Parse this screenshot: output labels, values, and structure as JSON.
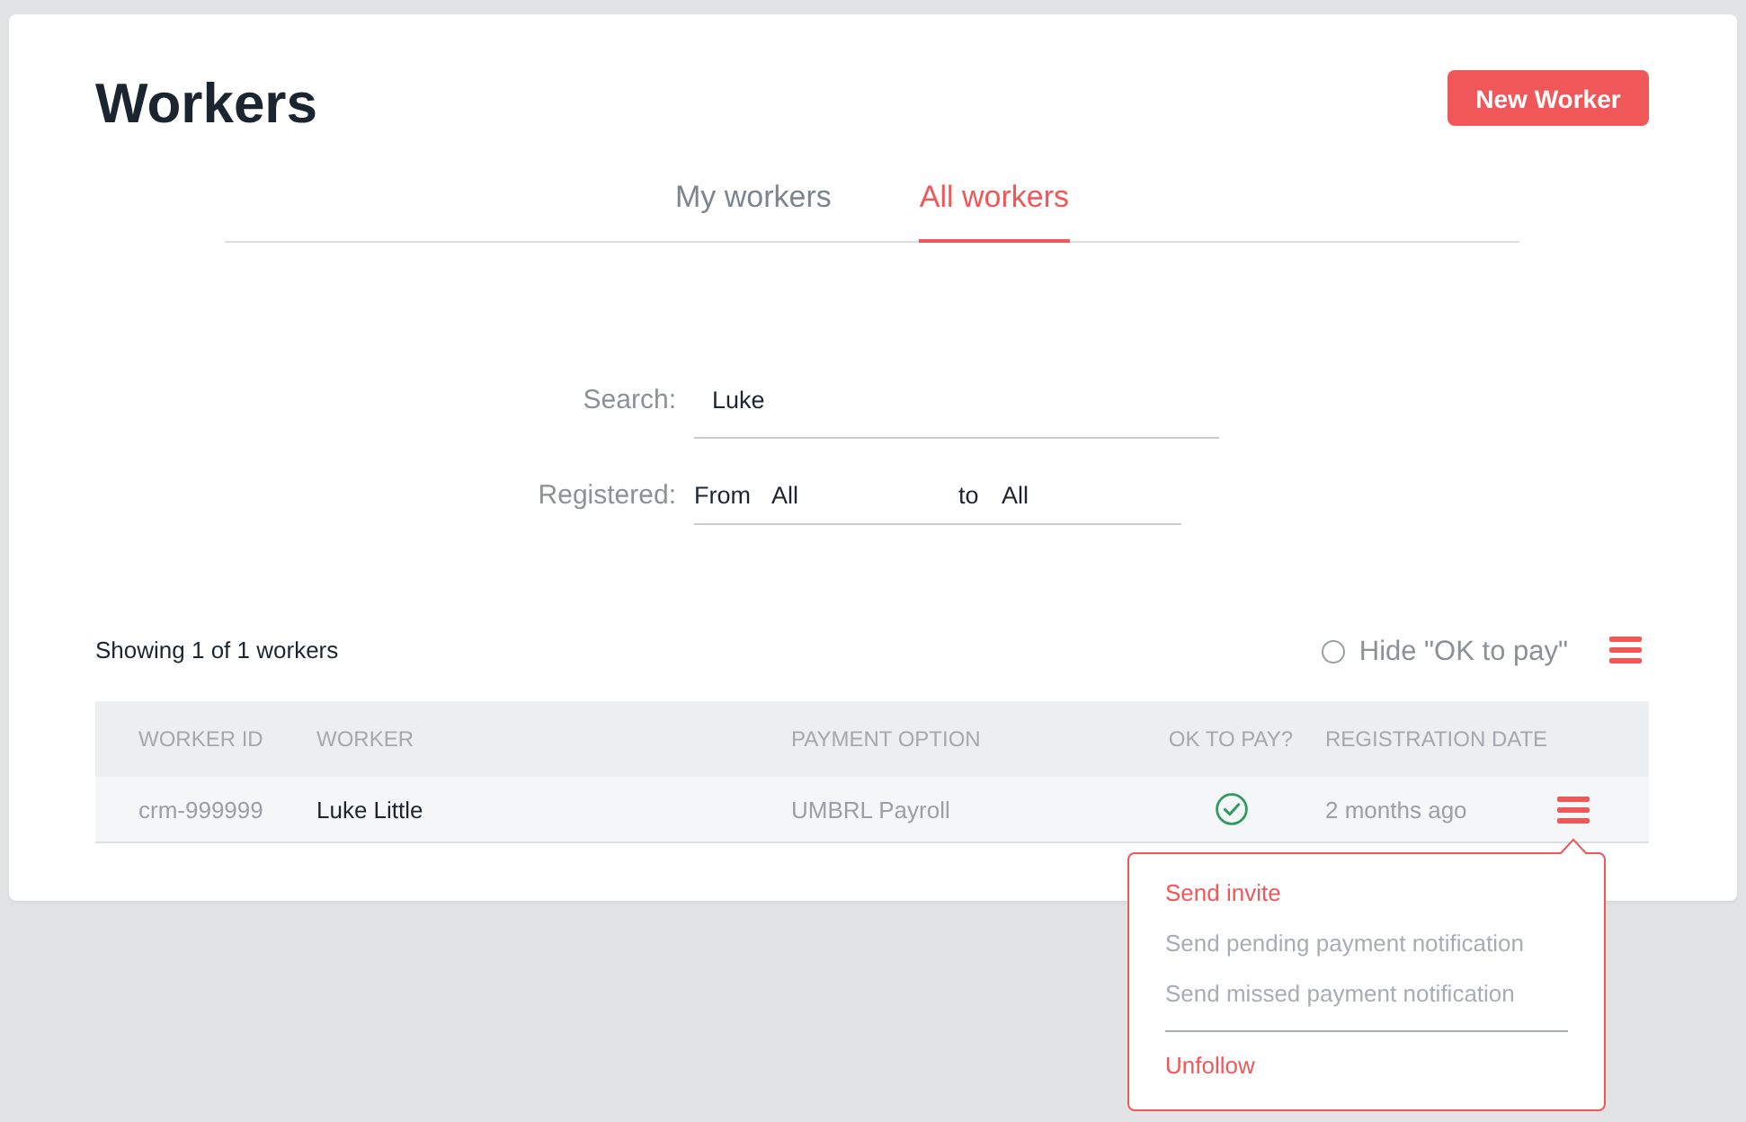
{
  "page": {
    "title": "Workers",
    "new_button": "New Worker"
  },
  "tabs": [
    {
      "label": "My workers",
      "selected": false
    },
    {
      "label": "All workers",
      "selected": true
    }
  ],
  "filters": {
    "search": {
      "label": "Search:",
      "value": "Luke"
    },
    "registered": {
      "label": "Registered:",
      "from_label": "From",
      "from_value": "All",
      "to_label": "to",
      "to_value": "All"
    }
  },
  "toolbar": {
    "summary": "Showing 1 of 1 workers",
    "hide_ok_to_pay": {
      "label": "Hide \"OK to pay\"",
      "checked": false
    }
  },
  "table": {
    "columns": [
      "WORKER ID",
      "WORKER",
      "PAYMENT OPTION",
      "OK TO PAY?",
      "REGISTRATION DATE"
    ],
    "rows": [
      {
        "worker_id": "crm-999999",
        "worker": "Luke Little",
        "payment_option": "UMBRL Payroll",
        "ok_to_pay": true,
        "registration_date": "2 months ago",
        "menu_expanded": true,
        "menu": {
          "sections": [
            {
              "items": [
                {
                  "label": "Send invite",
                  "disabled": false
                },
                {
                  "label": "Send pending payment notification",
                  "disabled": true
                },
                {
                  "label": "Send missed payment notification",
                  "disabled": true
                }
              ]
            },
            {
              "items": [
                {
                  "label": "Unfollow",
                  "disabled": false
                }
              ]
            }
          ]
        }
      }
    ]
  }
}
